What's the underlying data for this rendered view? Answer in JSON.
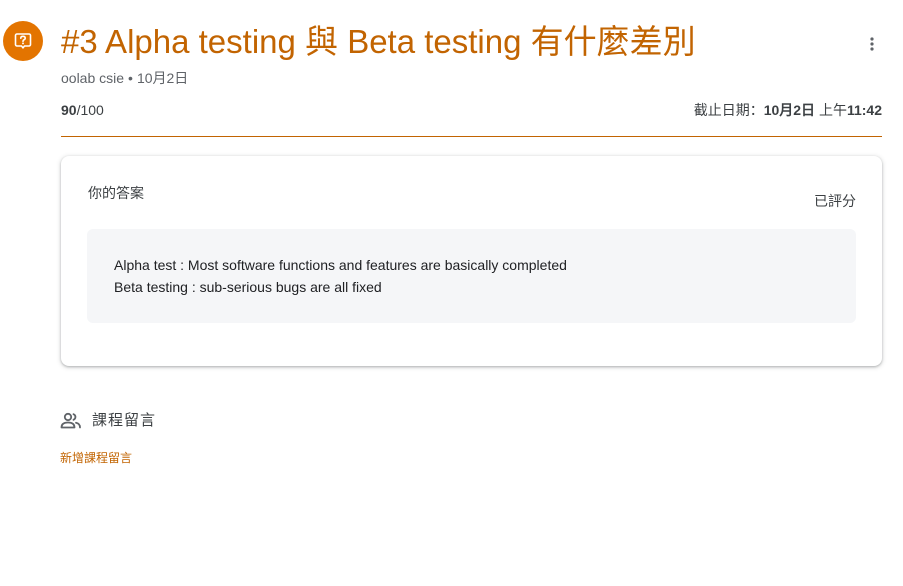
{
  "assignment": {
    "title": "#3 Alpha testing 與 Beta testing 有什麼差別",
    "author": "oolab csie",
    "separator": "•",
    "posted_date": "10月2日",
    "points_score": "90",
    "points_total": "/100",
    "due_prefix": "截止日期：",
    "due_date": "10月2日",
    "due_time_prefix": " 上午",
    "due_time": "11:42"
  },
  "answer_card": {
    "title": "你的答案",
    "status": "已評分",
    "lines": [
      "Alpha test : Most software functions and features are basically completed",
      "Beta testing : sub-serious bugs are all fixed"
    ]
  },
  "comments": {
    "label": "課程留言",
    "add_label": "新增課程留言"
  },
  "colors": {
    "accent": "#c26401",
    "icon_bg": "#e37400",
    "answer_bg": "#f5f6f8"
  },
  "icons": {
    "assignment": "question-icon",
    "more": "more-vert-icon",
    "comments": "people-icon"
  }
}
